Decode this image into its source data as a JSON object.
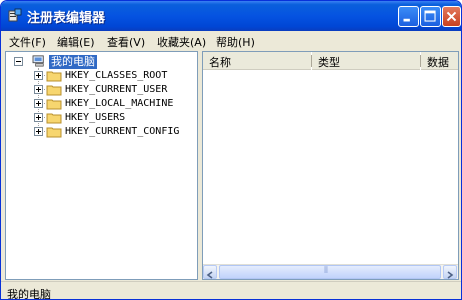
{
  "window": {
    "title": "注册表编辑器",
    "colors": {
      "titlebar": "#0553e1",
      "selection": "#316ac5",
      "close_button": "#c8401f"
    }
  },
  "menubar": {
    "items": [
      {
        "label": "文件(F)"
      },
      {
        "label": "编辑(E)"
      },
      {
        "label": "查看(V)"
      },
      {
        "label": "收藏夹(A)"
      },
      {
        "label": "帮助(H)"
      }
    ]
  },
  "tree": {
    "root": {
      "label": "我的电脑",
      "icon": "computer-icon"
    },
    "nodes": [
      {
        "label": "HKEY_CLASSES_ROOT",
        "icon": "folder-icon"
      },
      {
        "label": "HKEY_CURRENT_USER",
        "icon": "folder-icon"
      },
      {
        "label": "HKEY_LOCAL_MACHINE",
        "icon": "folder-icon"
      },
      {
        "label": "HKEY_USERS",
        "icon": "folder-icon"
      },
      {
        "label": "HKEY_CURRENT_CONFIG",
        "icon": "folder-icon"
      }
    ]
  },
  "list": {
    "columns": [
      {
        "label": "名称"
      },
      {
        "label": "类型"
      },
      {
        "label": "数据"
      }
    ],
    "scrollbar": {
      "thumb_glyph": "⦀"
    }
  },
  "statusbar": {
    "text": "我的电脑"
  }
}
